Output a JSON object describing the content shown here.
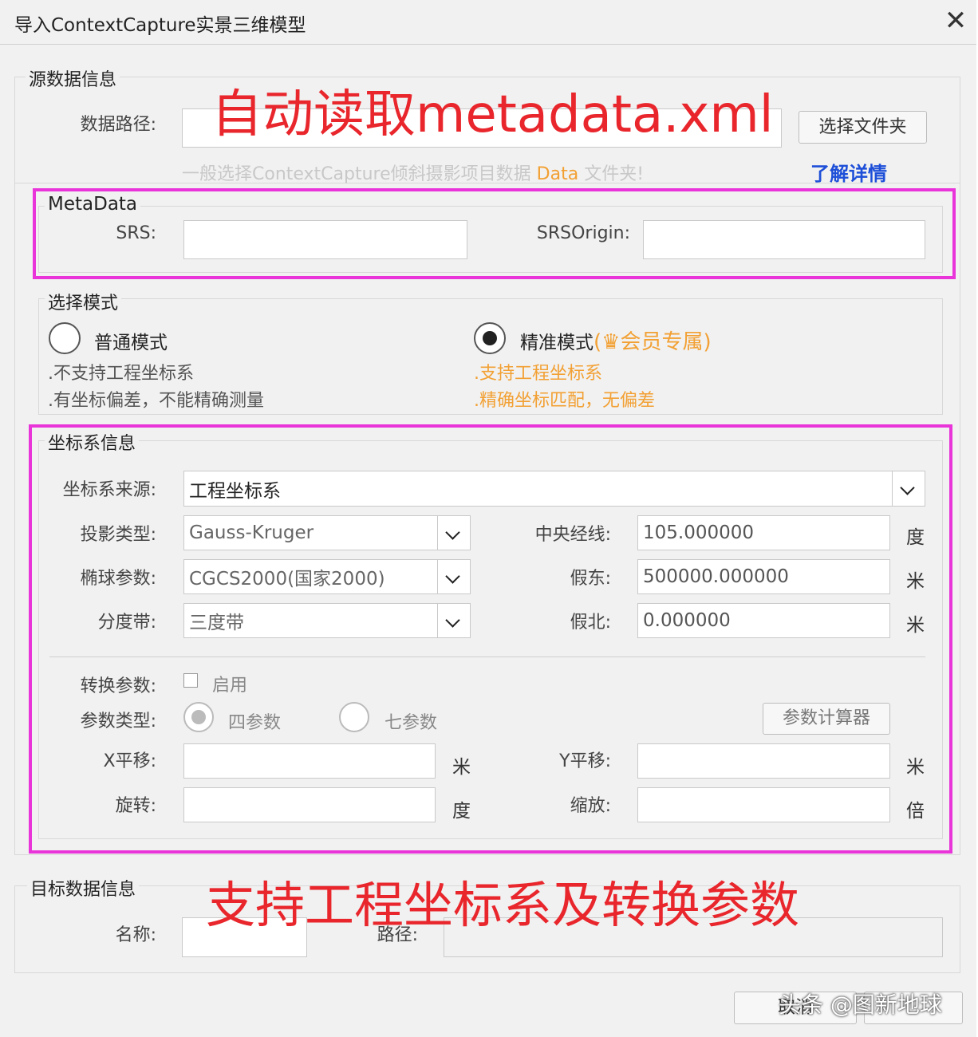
{
  "window": {
    "title": "导入ContextCapture实景三维模型",
    "close_glyph": "✕"
  },
  "source": {
    "legend": "源数据信息",
    "path_label": "数据路径:",
    "path_value": "",
    "select_folder_button": "选择文件夹",
    "hint_prefix": "一般选择ContextCapture倾斜摄影项目数据",
    "hint_highlight": "Data",
    "hint_suffix": "文件夹!",
    "learn_more_link": "了解详情"
  },
  "metadata": {
    "legend": "MetaData",
    "srs_label": "SRS:",
    "srs_value": "",
    "srsorigin_label": "SRSOrigin:",
    "srsorigin_value": ""
  },
  "mode": {
    "legend": "选择模式",
    "normal": {
      "label": "普通模式",
      "selected": false,
      "notes": [
        ".不支持工程坐标系",
        ".有坐标偏差，不能精确测量"
      ]
    },
    "precise": {
      "label": "精准模式",
      "member_tag": "(",
      "member_crown": "♛",
      "member_text": "会员专属",
      "member_close": ")",
      "selected": true,
      "notes": [
        ".支持工程坐标系",
        ".精确坐标匹配，无偏差"
      ]
    }
  },
  "coords": {
    "legend": "坐标系信息",
    "source_label": "坐标系来源:",
    "source_value": "工程坐标系",
    "projection_label": "投影类型:",
    "projection_value": "Gauss-Kruger",
    "ellipsoid_label": "椭球参数:",
    "ellipsoid_value": "CGCS2000(国家2000)",
    "zone_label": "分度带:",
    "zone_value": "三度带",
    "central_meridian_label": "中央经线:",
    "central_meridian_value": "105.000000",
    "central_meridian_unit": "度",
    "false_east_label": "假东:",
    "false_east_value": "500000.000000",
    "false_east_unit": "米",
    "false_north_label": "假北:",
    "false_north_value": "0.000000",
    "false_north_unit": "米",
    "transform_label": "转换参数:",
    "transform_enable": "启用",
    "param_type_label": "参数类型:",
    "four_param": "四参数",
    "seven_param": "七参数",
    "calculator_button": "参数计算器",
    "x_shift_label": "X平移:",
    "x_shift_unit": "米",
    "y_shift_label": "Y平移:",
    "y_shift_unit": "米",
    "rotation_label": "旋转:",
    "rotation_unit": "度",
    "scale_label": "缩放:",
    "scale_unit": "倍"
  },
  "target": {
    "legend": "目标数据信息",
    "name_label": "名称:",
    "path_label": "路径:"
  },
  "footer": {
    "cancel_button": "取消",
    "watermark": "头条 @图新地球"
  },
  "annotations": {
    "top": "自动读取metadata.xml",
    "bottom": "支持工程坐标系及转换参数",
    "color": "#e8262c",
    "highlight_color": "#e834d9"
  }
}
